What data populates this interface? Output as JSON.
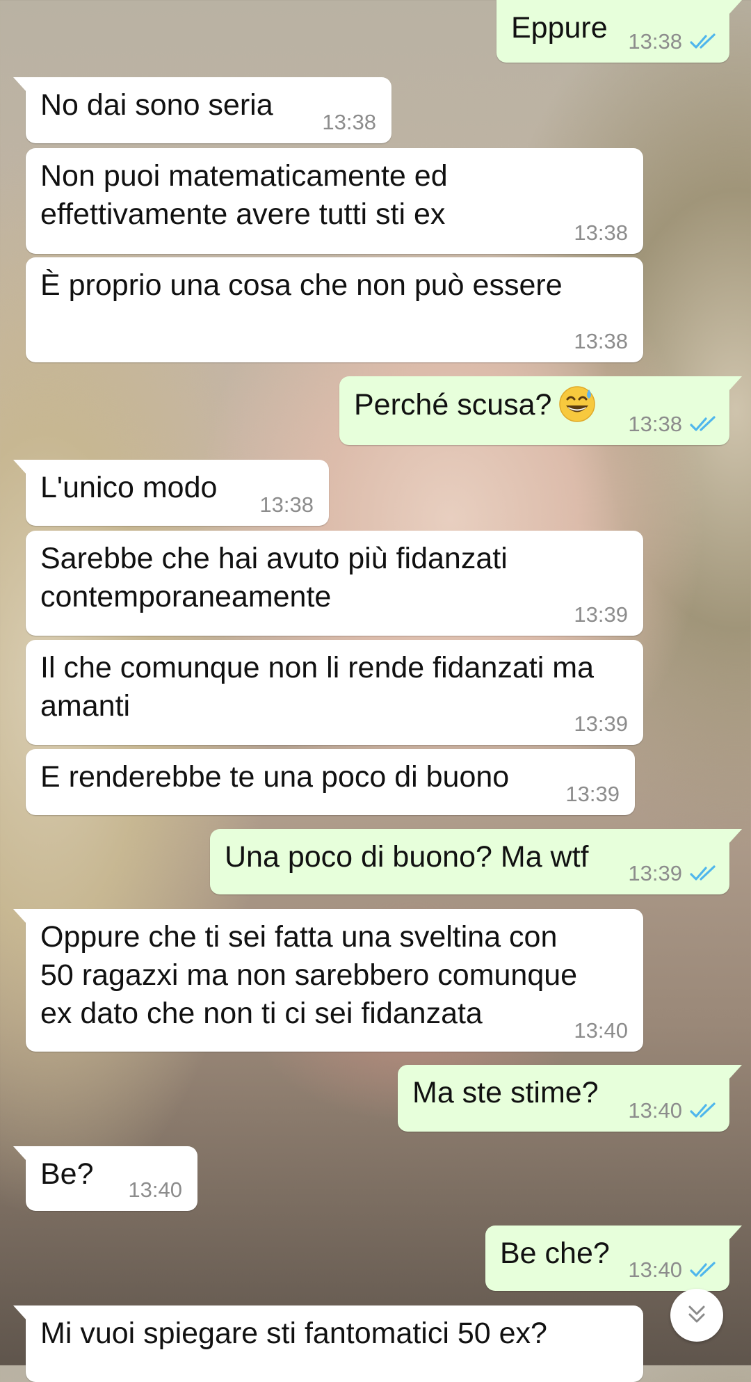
{
  "messages": [
    {
      "dir": "out",
      "text": "Eppure",
      "time": "13:38",
      "read": true
    },
    {
      "dir": "in",
      "text": "No dai sono seria",
      "time": "13:38"
    },
    {
      "dir": "in",
      "text": "Non puoi matematicamente ed\neffettivamente avere tutti sti ex",
      "time": "13:38"
    },
    {
      "dir": "in",
      "text": "È proprio una cosa che non può essere",
      "time": "13:38"
    },
    {
      "dir": "out",
      "text": "Perché scusa?",
      "emoji": "grinning-face-with-sweat",
      "time": "13:38",
      "read": true
    },
    {
      "dir": "in",
      "text": "L'unico modo",
      "time": "13:38"
    },
    {
      "dir": "in",
      "text": "Sarebbe che hai avuto più fidanzati\ncontemporaneamente",
      "time": "13:39"
    },
    {
      "dir": "in",
      "text": "Il che comunque non li rende fidanzati ma\namanti",
      "time": "13:39"
    },
    {
      "dir": "in",
      "text": "E renderebbe te una poco di buono",
      "time": "13:39"
    },
    {
      "dir": "out",
      "text": "Una poco di buono? Ma wtf",
      "time": "13:39",
      "read": true
    },
    {
      "dir": "in",
      "text": "Oppure che ti sei fatta una sveltina con\n50 ragazxi ma non sarebbero comunque\nex dato che non ti ci sei fidanzata",
      "time": "13:40"
    },
    {
      "dir": "out",
      "text": "Ma ste stime?",
      "time": "13:40",
      "read": true
    },
    {
      "dir": "in",
      "text": "Be?",
      "time": "13:40"
    },
    {
      "dir": "out",
      "text": "Be che?",
      "time": "13:40",
      "read": true
    },
    {
      "dir": "in",
      "text": "Mi vuoi spiegare sti fantomatici 50 ex?",
      "time": ""
    }
  ],
  "colors": {
    "incoming_bubble": "#ffffff",
    "outgoing_bubble": "#e7ffdb",
    "read_ticks": "#4fb6ec",
    "timestamp": "#8c8c8c"
  },
  "icons": {
    "read_receipt": "double-check-icon",
    "scroll_down": "double-chevron-down-icon"
  }
}
